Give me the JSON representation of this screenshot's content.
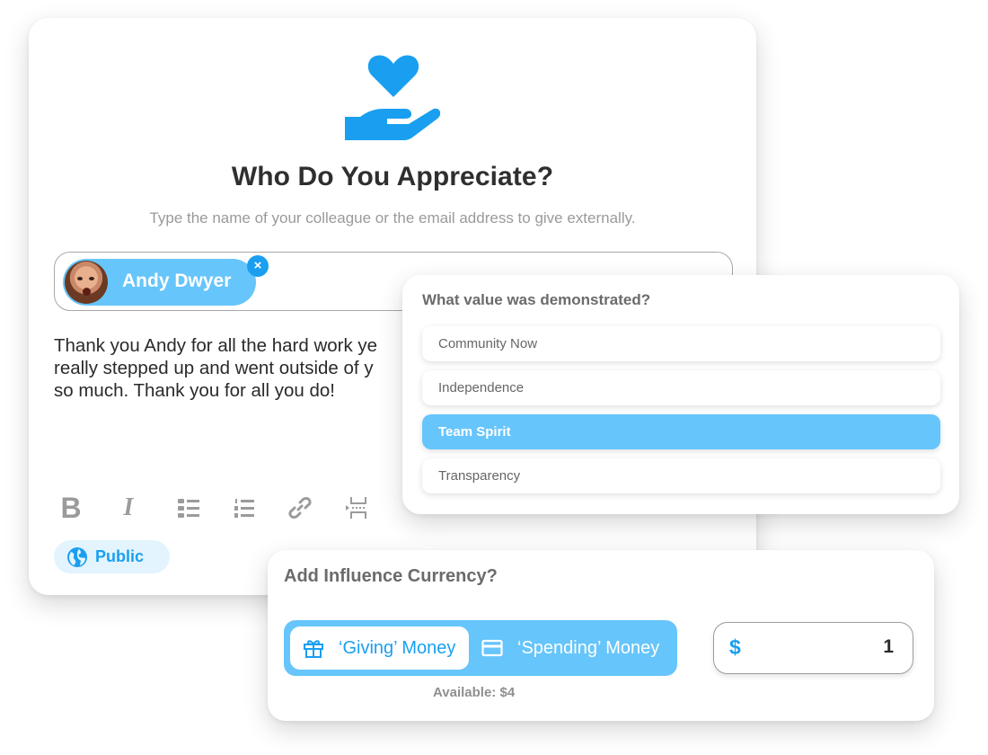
{
  "colors": {
    "accent": "#1a9ff0",
    "accent_light": "#66c5fb",
    "pill_bg": "#e3f4fe"
  },
  "appreciation": {
    "hero_icon": "heart-in-hand-icon",
    "title": "Who Do You Appreciate?",
    "subtitle": "Type the name of your colleague or the email address to give externally.",
    "recipient": {
      "name": "Andy Dwyer",
      "avatar_icon": "avatar",
      "remove_glyph": "×"
    },
    "message_lines": [
      "Thank you Andy for all the hard work ye",
      "really stepped up  and went outside of y",
      "so much. Thank you for all you do!"
    ],
    "toolbar": [
      {
        "name": "bold",
        "glyph": "B"
      },
      {
        "name": "italic",
        "glyph": "I"
      },
      {
        "name": "bulleted-list",
        "glyph": "bulleted-list-icon"
      },
      {
        "name": "numbered-list",
        "glyph": "numbered-list-icon"
      },
      {
        "name": "link",
        "glyph": "link-icon"
      },
      {
        "name": "page-break",
        "glyph": "page-break-icon"
      }
    ],
    "visibility": {
      "label": "Public",
      "icon": "globe-icon"
    }
  },
  "values": {
    "title": "What value was demonstrated?",
    "options": [
      {
        "label": "Community Now",
        "selected": false
      },
      {
        "label": "Independence",
        "selected": false
      },
      {
        "label": "Team Spirit",
        "selected": true
      },
      {
        "label": "Transparency",
        "selected": false
      }
    ]
  },
  "currency": {
    "title": "Add Influence Currency?",
    "options": [
      {
        "label": "‘Giving’ Money",
        "icon": "gift-icon",
        "active": true
      },
      {
        "label": "‘Spending’ Money",
        "icon": "credit-card-icon",
        "active": false
      }
    ],
    "available": "Available: $4",
    "amount": {
      "symbol": "$",
      "value": "1"
    }
  }
}
